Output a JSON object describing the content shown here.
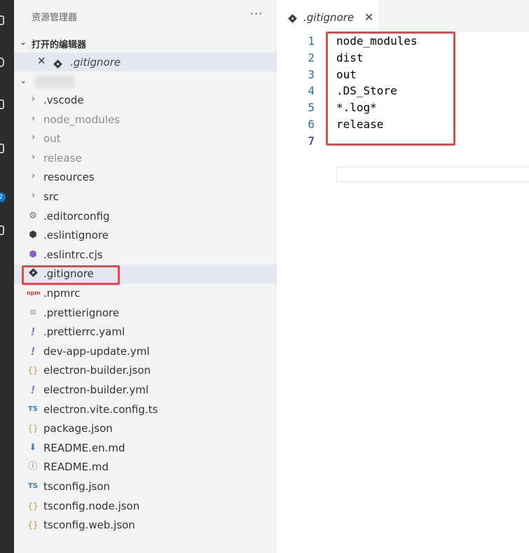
{
  "sidebar": {
    "title": "资源管理器",
    "more_glyph": "···",
    "open_editors": {
      "title": "打开的编辑器",
      "items": [
        {
          "close_glyph": "✕",
          "name": ".gitignore"
        }
      ]
    },
    "tree": [
      {
        "name": ".vscode",
        "type": "folder",
        "dim": false,
        "icon": "chevron-right-icon",
        "glyph": "›"
      },
      {
        "name": "node_modules",
        "type": "folder",
        "dim": true,
        "icon": "chevron-right-icon",
        "glyph": "›"
      },
      {
        "name": "out",
        "type": "folder",
        "dim": true,
        "icon": "chevron-right-icon",
        "glyph": "›"
      },
      {
        "name": "release",
        "type": "folder",
        "dim": true,
        "icon": "chevron-right-icon",
        "glyph": "›"
      },
      {
        "name": "resources",
        "type": "folder",
        "dim": false,
        "icon": "chevron-right-icon",
        "glyph": "›"
      },
      {
        "name": "src",
        "type": "folder",
        "dim": false,
        "icon": "chevron-right-icon",
        "glyph": "›"
      },
      {
        "name": ".editorconfig",
        "type": "file",
        "icon": "gear-icon",
        "glyph": "⚙",
        "color": "#6d6d6d"
      },
      {
        "name": ".eslintignore",
        "type": "file",
        "icon": "eslint-icon",
        "glyph": "⬢",
        "color": "#3a3a3a"
      },
      {
        "name": ".eslintrc.cjs",
        "type": "file",
        "icon": "eslint-purple-icon",
        "glyph": "⬢",
        "color": "#8a63c7"
      },
      {
        "name": ".gitignore",
        "type": "file",
        "icon": "git-icon",
        "glyph": "",
        "color": "#3b3b3b",
        "selected": true
      },
      {
        "name": ".npmrc",
        "type": "file",
        "icon": "npm-icon",
        "glyph": "npm",
        "color": "#cb3837"
      },
      {
        "name": ".prettierignore",
        "type": "file",
        "icon": "lines-icon",
        "glyph": "≡",
        "color": "#9a9a9a"
      },
      {
        "name": ".prettierrc.yaml",
        "type": "file",
        "icon": "yaml-icon",
        "glyph": "!",
        "color": "#a074c4"
      },
      {
        "name": "dev-app-update.yml",
        "type": "file",
        "icon": "yaml-icon",
        "glyph": "!",
        "color": "#a074c4"
      },
      {
        "name": "electron-builder.json",
        "type": "file",
        "icon": "json-icon",
        "glyph": "{}",
        "color": "#b7a23a"
      },
      {
        "name": "electron-builder.yml",
        "type": "file",
        "icon": "yaml-icon",
        "glyph": "!",
        "color": "#a074c4"
      },
      {
        "name": "electron.vite.config.ts",
        "type": "file",
        "icon": "typescript-icon",
        "glyph": "TS",
        "color": "#3b7abf"
      },
      {
        "name": "package.json",
        "type": "file",
        "icon": "json-icon",
        "glyph": "{}",
        "color": "#b7a23a"
      },
      {
        "name": "README.en.md",
        "type": "file",
        "icon": "download-arrow-icon",
        "glyph": "⬇",
        "color": "#4b7db5"
      },
      {
        "name": "README.md",
        "type": "file",
        "icon": "info-icon",
        "glyph": "ⓘ",
        "color": "#4b7db5"
      },
      {
        "name": "tsconfig.json",
        "type": "file",
        "icon": "tsconfig-icon",
        "glyph": "TS",
        "color": "#3b7abf"
      },
      {
        "name": "tsconfig.node.json",
        "type": "file",
        "icon": "json-icon",
        "glyph": "{}",
        "color": "#b7a23a"
      },
      {
        "name": "tsconfig.web.json",
        "type": "file",
        "icon": "json-icon",
        "glyph": "{}",
        "color": "#b7a23a"
      }
    ]
  },
  "editor": {
    "tab": {
      "name": ".gitignore",
      "close_glyph": "✕"
    },
    "lines": [
      {
        "num": "1",
        "text": "node_modules"
      },
      {
        "num": "2",
        "text": "dist"
      },
      {
        "num": "3",
        "text": "out"
      },
      {
        "num": "4",
        "text": ".DS_Store"
      },
      {
        "num": "5",
        "text": "*.log*"
      },
      {
        "num": "6",
        "text": "release"
      },
      {
        "num": "7",
        "text": ""
      }
    ]
  },
  "activity": {
    "badge": "2"
  },
  "colors": {
    "highlight": "#e04a4f",
    "selection": "#e4e6f1",
    "line_number": "#237893"
  }
}
